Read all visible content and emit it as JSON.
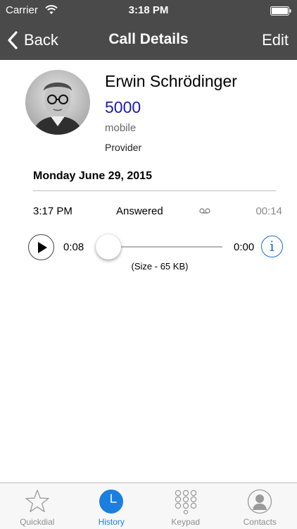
{
  "status_bar": {
    "carrier": "Carrier",
    "time": "3:18 PM"
  },
  "nav": {
    "back_label": "Back",
    "title": "Call Details",
    "edit_label": "Edit"
  },
  "contact": {
    "name": "Erwin Schrödinger",
    "number": "5000",
    "number_type": "mobile",
    "provider": "Provider"
  },
  "call": {
    "date": "Monday June 29, 2015",
    "time": "3:17 PM",
    "status": "Answered",
    "duration": "00:14"
  },
  "player": {
    "elapsed": "0:08",
    "remaining": "0:00",
    "position": 0,
    "file_size": "(Size - 65 KB)"
  },
  "tabs": [
    {
      "label": "Quickdial",
      "icon": "star-icon",
      "active": false
    },
    {
      "label": "History",
      "icon": "clock-icon",
      "active": true
    },
    {
      "label": "Keypad",
      "icon": "keypad-icon",
      "active": false
    },
    {
      "label": "Contacts",
      "icon": "contacts-icon",
      "active": false
    }
  ],
  "colors": {
    "header_bg": "#4a4a4a",
    "number": "#1c1ca8",
    "accent": "#1a7fe0",
    "info": "#1a6fd0"
  }
}
